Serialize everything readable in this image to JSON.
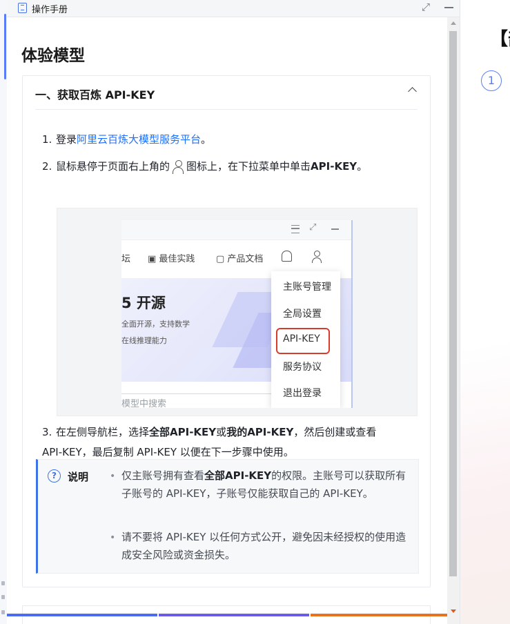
{
  "panel": {
    "title": "操作手册",
    "page_title": "体验模型"
  },
  "section": {
    "heading": "一、获取百炼 API-KEY",
    "step1": {
      "num": "1.",
      "prefix": "登录",
      "link": "阿里云百炼大模型服务平台",
      "suffix": "。"
    },
    "step2": {
      "num": "2.",
      "part1": "鼠标悬停于页面右上角的",
      "part2": "图标上，在下拉菜单中单击",
      "bold": "API-KEY",
      "end": "。"
    },
    "step3": {
      "num": "3.",
      "part1": "在左侧导航栏，选择",
      "bold1": "全部API-KEY",
      "part2": "或",
      "bold2": "我的API-KEY",
      "part3": "，然后创建或查看",
      "part4": "API-KEY，最后复制 API-KEY 以便在下一步骤中使用。"
    }
  },
  "screenshot": {
    "nav": [
      "坛",
      "最佳实践",
      "产品文档"
    ],
    "banner_title": "5 开源",
    "banner_lines": [
      "全面开源，支持数学",
      "在线推理能力"
    ],
    "search_placeholder": "模型中搜索",
    "dropdown": [
      "主账号管理",
      "全局设置",
      "API-KEY",
      "服务协议",
      "退出登录"
    ]
  },
  "note": {
    "icon": "?",
    "label": "说明",
    "item1": {
      "part1": "仅主账号拥有查看",
      "bold": "全部API-KEY",
      "part2": "的权限。主账号可以获取所有子账号的 API-KEY，子账号仅能获取自己的 API-KEY。"
    },
    "item2": "请不要将 API-KEY 以任何方式公开，避免因未经授权的使用造成安全风险或资金损失。"
  },
  "background": {
    "bracket_text": "【部",
    "circle_number": "1"
  },
  "colors": {
    "link": "#1f6fff",
    "accent": "#3e73e8",
    "highlight_box": "#d93b2b"
  }
}
